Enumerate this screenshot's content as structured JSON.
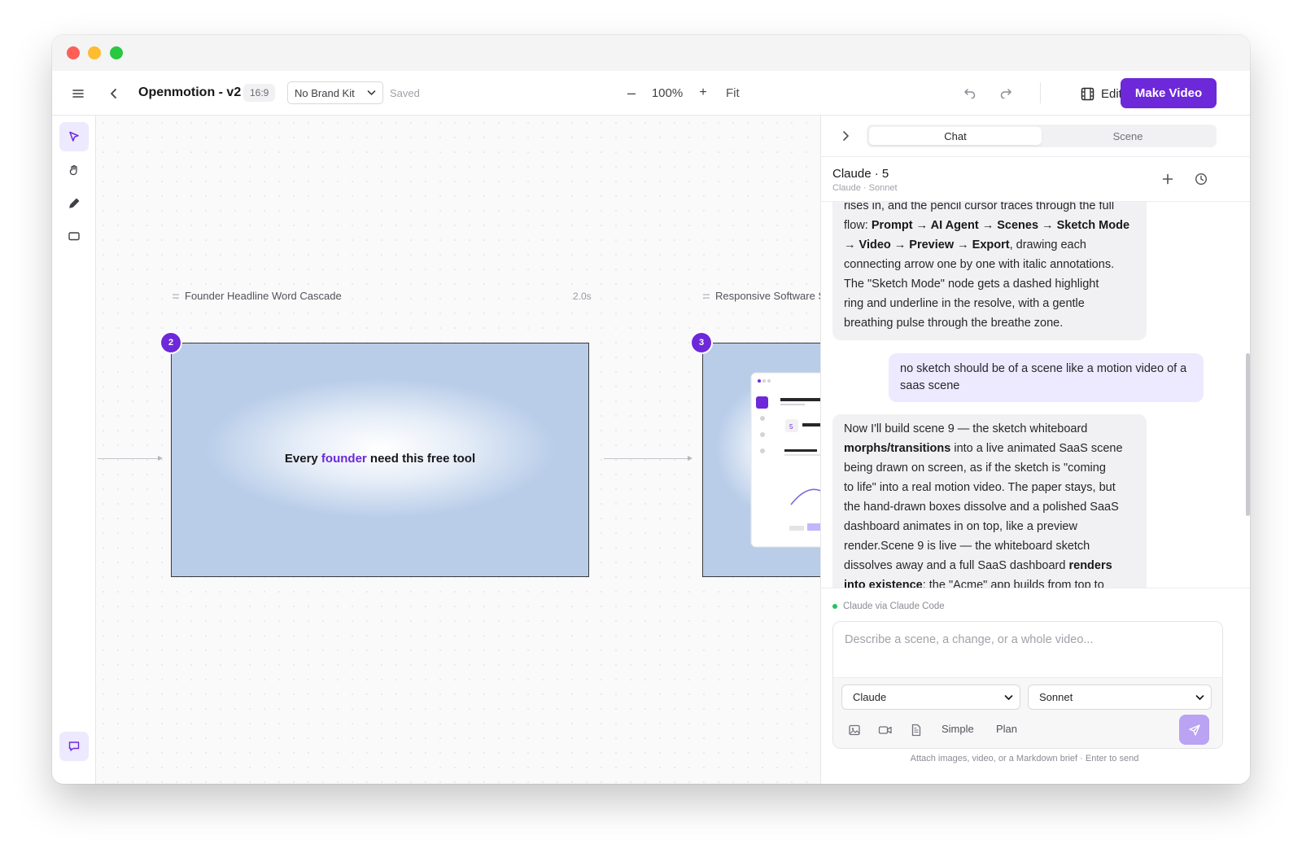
{
  "toolbar": {
    "title": "Openmotion - v2",
    "ratio": "16:9",
    "brand_kit": "No Brand Kit",
    "status": "Saved",
    "zoom_minus": "–",
    "zoom_level": "100%",
    "zoom_plus": "+",
    "fit_label": "Fit",
    "edit_label": "Edit",
    "make_video_label": "Make Video"
  },
  "tools": [
    "select-icon",
    "hand-icon",
    "pencil-icon",
    "rectangle-icon",
    "chat-bubble-icon"
  ],
  "canvas": {
    "scenes": [
      {
        "number": "2",
        "title": "Founder Headline Word Cascade",
        "duration": "2.0s",
        "text_before": "Every",
        "text_accent": "founder",
        "text_after": "need this free tool"
      },
      {
        "number": "3",
        "title": "Responsive Software Sc",
        "thumb_badge": "5"
      }
    ]
  },
  "panel": {
    "tabs": [
      "Chat",
      "Scene"
    ],
    "active_tab": "Chat",
    "chat_title": "Claude · 5",
    "chat_subtitle": "Claude · Sonnet",
    "messages": {
      "m1_l1": "rises in, and the pencil cursor traces through the full",
      "m1_l2_a": "flow: ",
      "m1_l2_b": "Prompt → AI Agent → Scenes → Sketch Mode",
      "m1_l3_a": "→ Video → Preview → Export",
      "m1_l3_b": ", drawing each",
      "m1_l4": "connecting arrow one by one with italic annotations.",
      "m1_l5": "The \"Sketch Mode\" node gets a dashed highlight",
      "m1_l6": "ring and underline in the resolve, with a gentle",
      "m1_l7": "breathing pulse through the breathe zone.",
      "user": "no sketch should be of a scene like a motion video of a saas scene",
      "m2_l1": "Now I'll build scene 9 — the sketch whiteboard",
      "m2_l2_b": "morphs/transitions",
      "m2_l2_a": " into a live animated SaaS scene",
      "m2_l3": "being drawn on screen, as if the sketch is \"coming",
      "m2_l4": "to life\" into a real motion video. The paper stays, but",
      "m2_l5": "the hand-drawn boxes dissolve and a polished SaaS",
      "m2_l6": "dashboard animates in on top, like a preview",
      "m2_l7": "render.Scene 9 is live — the whiteboard sketch",
      "m2_l8_a": "dissolves away and a full SaaS dashboard ",
      "m2_l8_b": "renders",
      "m2_l9_b": "into existence",
      "m2_l9_a": ": the \"Acme\" app builds from top to"
    },
    "via": "Claude via Claude Code",
    "prompt_placeholder": "Describe a scene, a change, or a whole video...",
    "provider": "Claude",
    "model": "Sonnet",
    "mode_simple": "Simple",
    "mode_plan": "Plan",
    "hint": "Attach images, video, or a Markdown brief · Enter to send"
  },
  "colors": {
    "accent": "#6d28d9",
    "accent_light": "#ede9fe",
    "online": "#22c55e"
  }
}
